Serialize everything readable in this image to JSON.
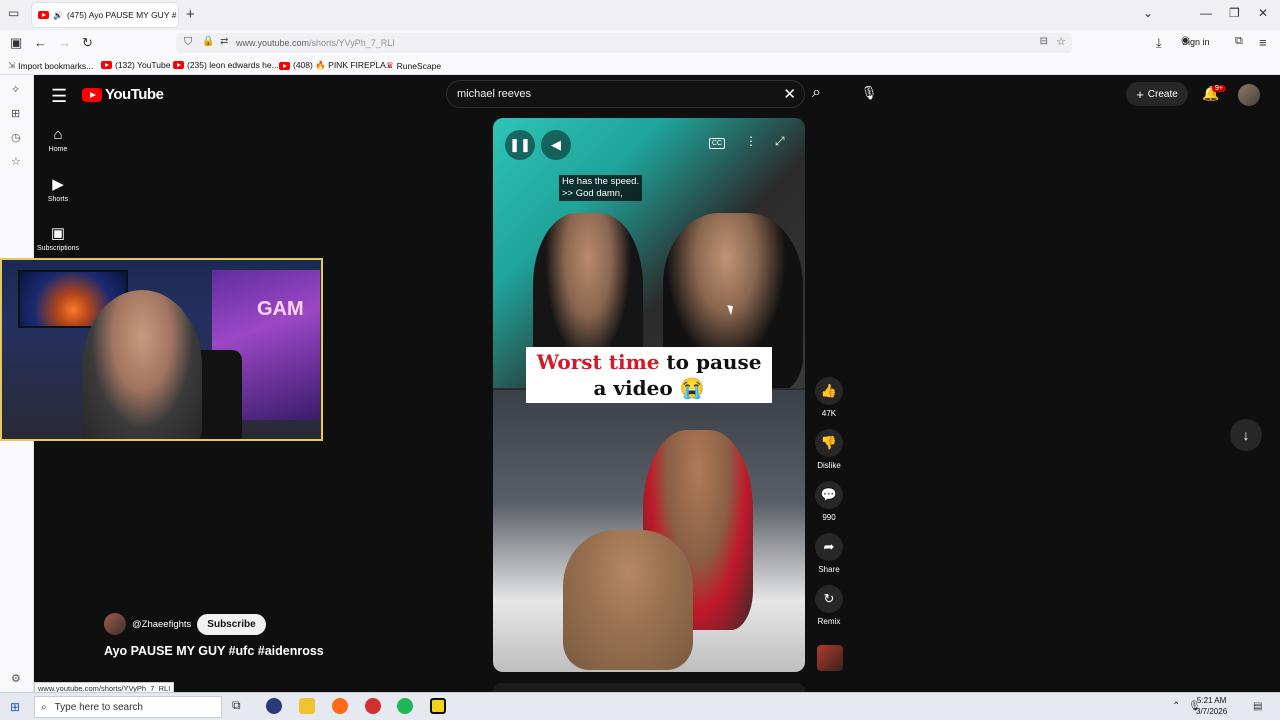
{
  "browser": {
    "tab_title": "(475) Ayo PAUSE MY GUY #",
    "url_prefix": "www.youtube.com",
    "url_path": "/shorts/YVyPh_7_RLI",
    "sign_in": "Sign in",
    "bookmarks": [
      {
        "label": "Import bookmarks...",
        "icon": "import-icon"
      },
      {
        "label": "(132) YouTube",
        "icon": "youtube-icon"
      },
      {
        "label": "(235) leon edwards he...",
        "icon": "youtube-icon"
      },
      {
        "label": "(408) 🔥 PINK FIREPLA...",
        "icon": "youtube-icon"
      },
      {
        "label": "RuneScape",
        "icon": "runescape-icon"
      }
    ],
    "status_url": "www.youtube.com/shorts/YVyPh_7_RLI"
  },
  "youtube": {
    "logo_text": "YouTube",
    "search_value": "michael reeves",
    "create_label": "Create",
    "notif_badge": "9+",
    "guide": [
      {
        "label": "Home",
        "icon": "home-icon"
      },
      {
        "label": "Shorts",
        "icon": "shorts-icon"
      },
      {
        "label": "Subscriptions",
        "icon": "subscriptions-icon"
      }
    ],
    "short": {
      "caption_line1": "He has the speed.",
      "caption_line2": ">> God damn,",
      "overlay_red": "Worst time",
      "overlay_rest1": " to pause",
      "overlay_rest2": "a video 😭",
      "cc_label": "CC"
    },
    "actions": {
      "likes": "47K",
      "dislike": "Dislike",
      "comments": "990",
      "share": "Share",
      "remix": "Remix"
    },
    "channel": "@Zhaeefights",
    "subscribe": "Subscribe",
    "video_title": "Ayo PAUSE MY GUY #ufc #aidenross"
  },
  "webcam": {
    "neon_text": "GAM"
  },
  "taskbar": {
    "search_placeholder": "Type here to search",
    "time": "5:21 AM",
    "date": "3/7/2026"
  }
}
